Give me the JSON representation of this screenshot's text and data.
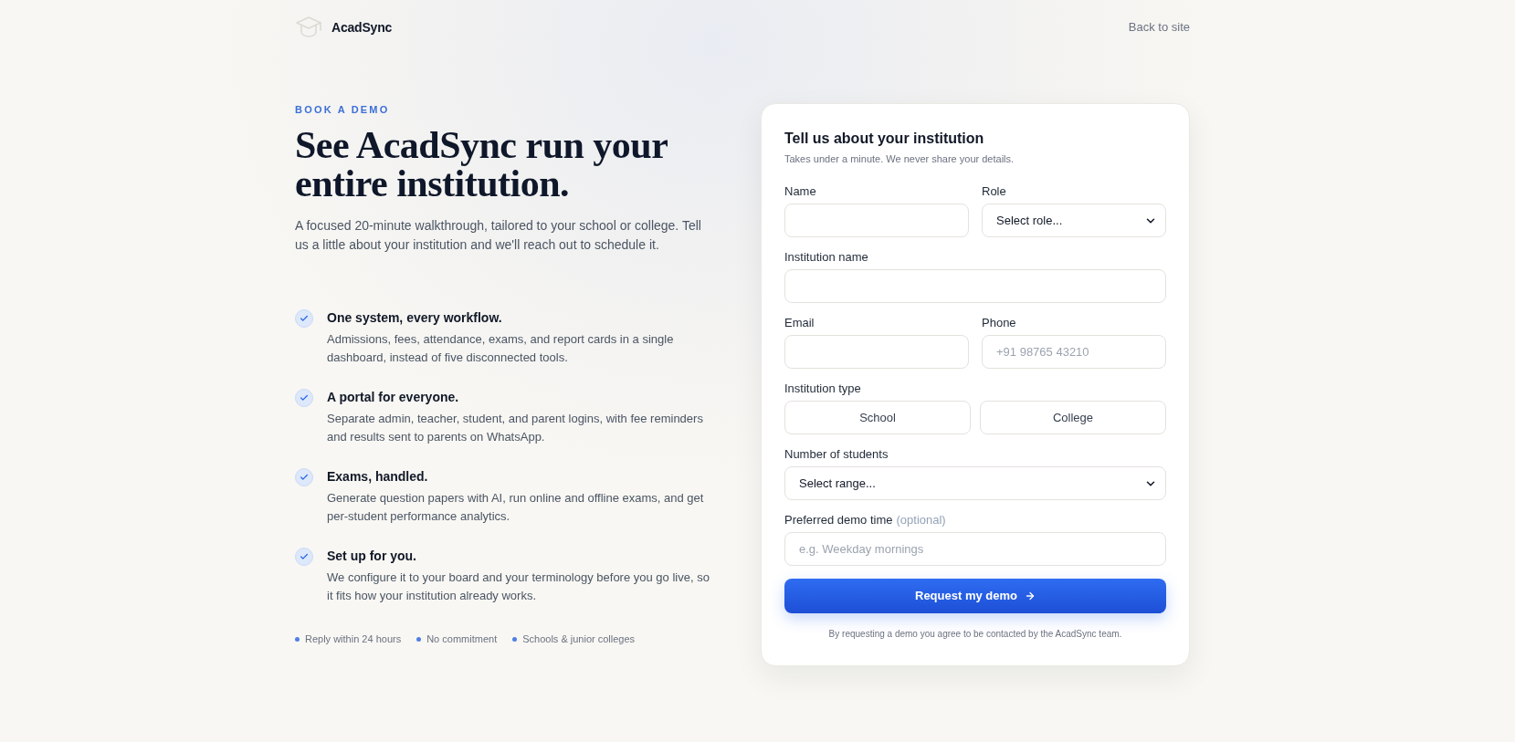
{
  "header": {
    "brand": "AcadSync",
    "back_link": "Back to site"
  },
  "hero": {
    "eyebrow": "BOOK A DEMO",
    "headline_lines": [
      "See AcadSync run your",
      "entire institution."
    ],
    "intro_lines": [
      "A focused 20-minute walkthrough, tailored to your school or college. Tell",
      "us a little about your institution and we'll reach out to schedule it."
    ]
  },
  "features": [
    {
      "title": "One system, every workflow.",
      "description_lines": [
        "Admissions, fees, attendance, exams, and report cards in a single",
        "dashboard, instead of five disconnected tools."
      ]
    },
    {
      "title": "A portal for everyone.",
      "description_lines": [
        "Separate admin, teacher, student, and parent logins, with fee reminders",
        "and results sent to parents on WhatsApp."
      ]
    },
    {
      "title": "Exams, handled.",
      "description_lines": [
        "Generate question papers with AI, run online and offline exams, and get",
        "per-student performance analytics."
      ]
    },
    {
      "title": "Set up for you.",
      "description_lines": [
        "We configure it to your board and your terminology before you go live, so",
        "it fits how your institution already works."
      ]
    }
  ],
  "assurances": [
    "Reply within 24 hours",
    "No commitment",
    "Schools & junior colleges"
  ],
  "form": {
    "title": "Tell us about your institution",
    "subtitle": "Takes under a minute. We never share your details.",
    "rows": [
      {
        "fields": [
          {
            "kind": "text",
            "label": "Name"
          },
          {
            "kind": "select",
            "label": "Role",
            "value": "Select role..."
          }
        ]
      },
      {
        "fields": [
          {
            "kind": "text",
            "label": "Institution name"
          }
        ]
      },
      {
        "fields": [
          {
            "kind": "text",
            "label": "Email"
          },
          {
            "kind": "text",
            "label": "Phone",
            "placeholder": "+91 98765 43210"
          }
        ]
      },
      {
        "fields": [
          {
            "kind": "choice",
            "label": "Institution type",
            "options": [
              {
                "label": "School",
                "selected": false
              },
              {
                "label": "College",
                "selected": false
              }
            ]
          }
        ]
      },
      {
        "fields": [
          {
            "kind": "select",
            "label": "Number of students",
            "value": "Select range..."
          }
        ]
      },
      {
        "fields": [
          {
            "kind": "text",
            "label": "Preferred demo time",
            "note": "(optional)",
            "placeholder": "e.g. Weekday mornings"
          }
        ]
      }
    ],
    "submit": "Request my demo",
    "disclaimer": "By requesting a demo you agree to be contacted by the AcadSync team."
  }
}
